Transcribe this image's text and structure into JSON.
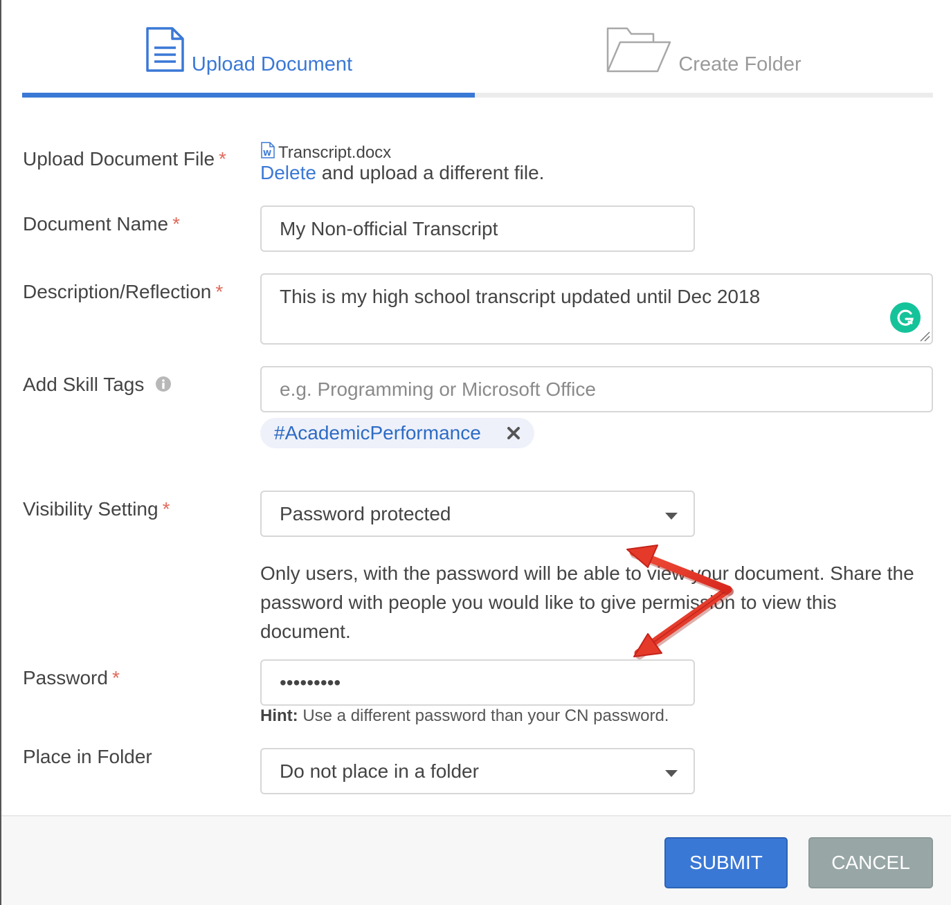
{
  "tabs": [
    {
      "label": "Upload Document",
      "icon": "document-icon",
      "active": true
    },
    {
      "label": "Create Folder",
      "icon": "folder-icon",
      "active": false
    }
  ],
  "form": {
    "upload_file": {
      "label": "Upload Document File",
      "required_mark": "*",
      "file_name": "Transcript.docx",
      "delete_link": "Delete",
      "delete_suffix": " and upload a different file."
    },
    "document_name": {
      "label": "Document Name",
      "required_mark": "*",
      "value": "My Non-official Transcript"
    },
    "description": {
      "label": "Description/Reflection",
      "required_mark": "*",
      "value": "This is my high school transcript updated until Dec 2018"
    },
    "skill_tags": {
      "label": "Add Skill Tags",
      "placeholder": "e.g. Programming or Microsoft Office",
      "tags": [
        "#AcademicPerformance"
      ]
    },
    "visibility": {
      "label": "Visibility Setting",
      "required_mark": "*",
      "value": "Password protected",
      "help_text": "Only users, with the password will be able to view your document. Share the password with people you would like to give permission to view this document."
    },
    "password": {
      "label": "Password",
      "required_mark": "*",
      "value": "•••••••••",
      "hint_label": "Hint:",
      "hint_text": " Use a different password than your CN password."
    },
    "folder": {
      "label": "Place in Folder",
      "value": "Do not place in a folder"
    }
  },
  "buttons": {
    "submit": "SUBMIT",
    "cancel": "CANCEL"
  },
  "colors": {
    "accent": "#3a78d6",
    "required": "#e06a5a",
    "cancel": "#98a6a6",
    "annotation_arrow": "#e8392b",
    "grammarly": "#15c39a"
  }
}
